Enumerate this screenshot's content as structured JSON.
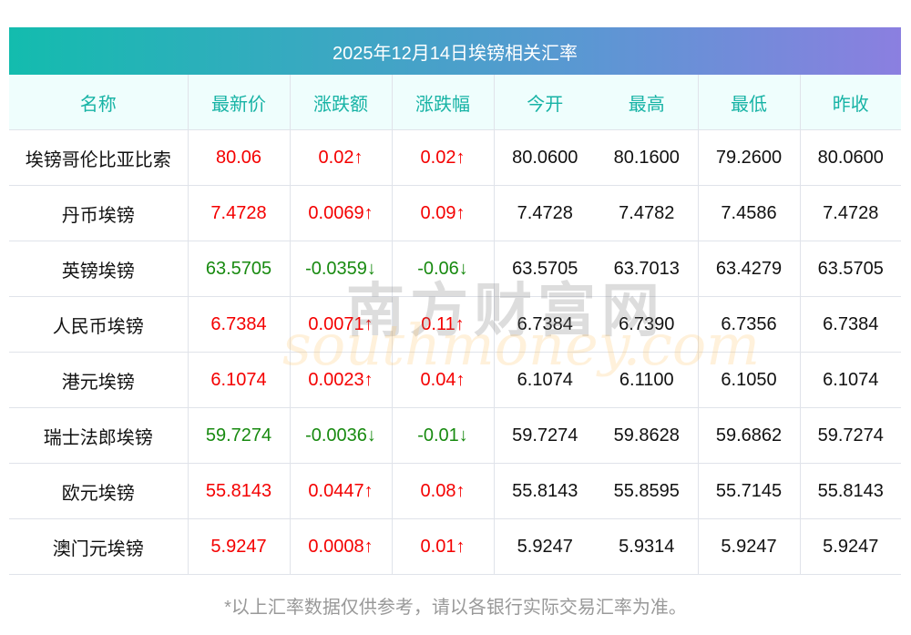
{
  "title": "2025年12月14日埃镑相关汇率",
  "columns": [
    "名称",
    "最新价",
    "涨跌额",
    "涨跌幅",
    "今开",
    "最高",
    "最低",
    "昨收"
  ],
  "rows": [
    {
      "name": "埃镑哥伦比亚比索",
      "price": "80.06",
      "change": "0.02↑",
      "pct": "0.02↑",
      "open": "80.0600",
      "high": "80.1600",
      "low": "79.2600",
      "prev": "80.0600",
      "dir": "up"
    },
    {
      "name": "丹币埃镑",
      "price": "7.4728",
      "change": "0.0069↑",
      "pct": "0.09↑",
      "open": "7.4728",
      "high": "7.4782",
      "low": "7.4586",
      "prev": "7.4728",
      "dir": "up"
    },
    {
      "name": "英镑埃镑",
      "price": "63.5705",
      "change": "-0.0359↓",
      "pct": "-0.06↓",
      "open": "63.5705",
      "high": "63.7013",
      "low": "63.4279",
      "prev": "63.5705",
      "dir": "down"
    },
    {
      "name": "人民币埃镑",
      "price": "6.7384",
      "change": "0.0071↑",
      "pct": "0.11↑",
      "open": "6.7384",
      "high": "6.7390",
      "low": "6.7356",
      "prev": "6.7384",
      "dir": "up"
    },
    {
      "name": "港元埃镑",
      "price": "6.1074",
      "change": "0.0023↑",
      "pct": "0.04↑",
      "open": "6.1074",
      "high": "6.1100",
      "low": "6.1050",
      "prev": "6.1074",
      "dir": "up"
    },
    {
      "name": "瑞士法郎埃镑",
      "price": "59.7274",
      "change": "-0.0036↓",
      "pct": "-0.01↓",
      "open": "59.7274",
      "high": "59.8628",
      "low": "59.6862",
      "prev": "59.7274",
      "dir": "down"
    },
    {
      "name": "欧元埃镑",
      "price": "55.8143",
      "change": "0.0447↑",
      "pct": "0.08↑",
      "open": "55.8143",
      "high": "55.8595",
      "low": "55.7145",
      "prev": "55.8143",
      "dir": "up"
    },
    {
      "name": "澳门元埃镑",
      "price": "5.9247",
      "change": "0.0008↑",
      "pct": "0.01↑",
      "open": "5.9247",
      "high": "5.9314",
      "low": "5.9247",
      "prev": "5.9247",
      "dir": "up"
    }
  ],
  "footer": "*以上汇率数据仅供参考，请以各银行实际交易汇率为准。",
  "watermark": {
    "cn": "南方财富网",
    "en": "southmoney.com"
  },
  "colors": {
    "up": "#f40000",
    "down": "#188a10",
    "header_text": "#17b3a5"
  }
}
